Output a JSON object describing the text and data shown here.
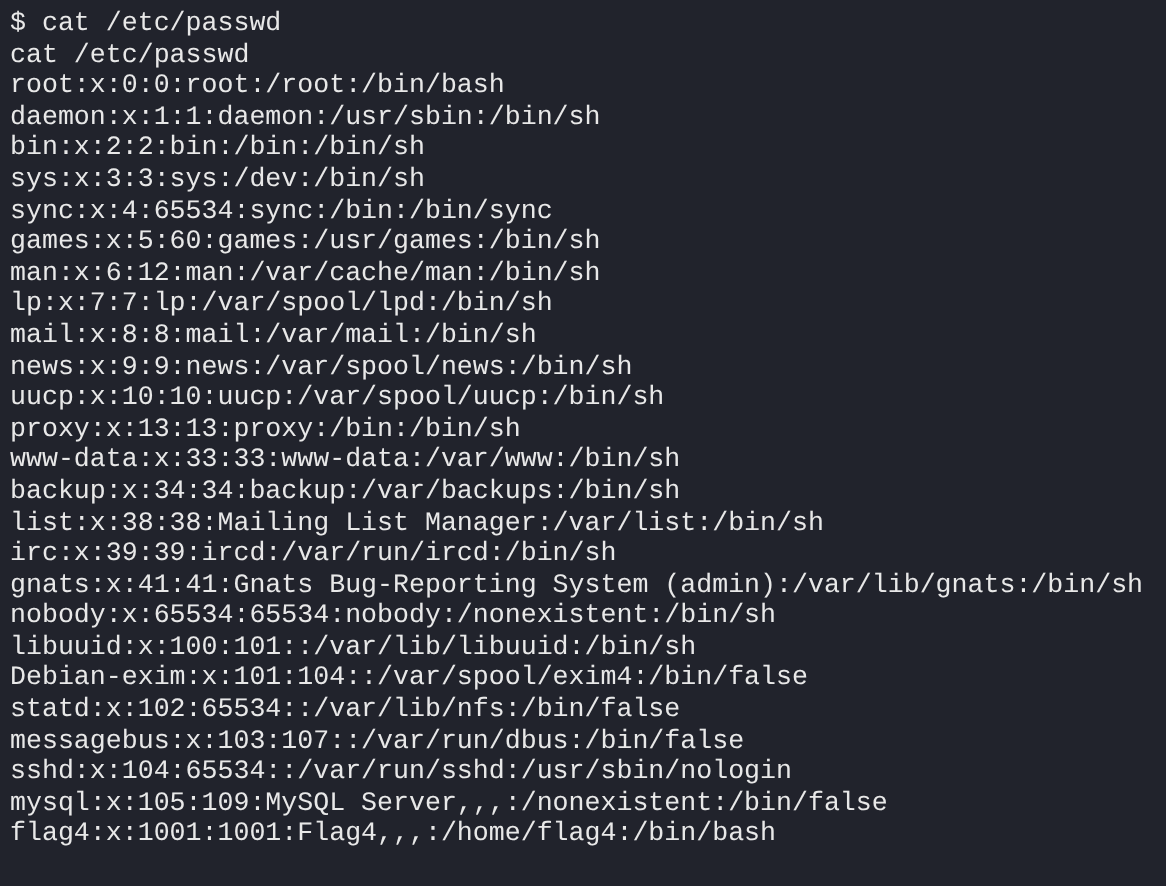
{
  "terminal": {
    "lines": [
      "$ cat /etc/passwd",
      "cat /etc/passwd",
      "root:x:0:0:root:/root:/bin/bash",
      "daemon:x:1:1:daemon:/usr/sbin:/bin/sh",
      "bin:x:2:2:bin:/bin:/bin/sh",
      "sys:x:3:3:sys:/dev:/bin/sh",
      "sync:x:4:65534:sync:/bin:/bin/sync",
      "games:x:5:60:games:/usr/games:/bin/sh",
      "man:x:6:12:man:/var/cache/man:/bin/sh",
      "lp:x:7:7:lp:/var/spool/lpd:/bin/sh",
      "mail:x:8:8:mail:/var/mail:/bin/sh",
      "news:x:9:9:news:/var/spool/news:/bin/sh",
      "uucp:x:10:10:uucp:/var/spool/uucp:/bin/sh",
      "proxy:x:13:13:proxy:/bin:/bin/sh",
      "www-data:x:33:33:www-data:/var/www:/bin/sh",
      "backup:x:34:34:backup:/var/backups:/bin/sh",
      "list:x:38:38:Mailing List Manager:/var/list:/bin/sh",
      "irc:x:39:39:ircd:/var/run/ircd:/bin/sh",
      "gnats:x:41:41:Gnats Bug-Reporting System (admin):/var/lib/gnats:/bin/sh",
      "nobody:x:65534:65534:nobody:/nonexistent:/bin/sh",
      "libuuid:x:100:101::/var/lib/libuuid:/bin/sh",
      "Debian-exim:x:101:104::/var/spool/exim4:/bin/false",
      "statd:x:102:65534::/var/lib/nfs:/bin/false",
      "messagebus:x:103:107::/var/run/dbus:/bin/false",
      "sshd:x:104:65534::/var/run/sshd:/usr/sbin/nologin",
      "mysql:x:105:109:MySQL Server,,,:/nonexistent:/bin/false",
      "flag4:x:1001:1001:Flag4,,,:/home/flag4:/bin/bash"
    ]
  }
}
